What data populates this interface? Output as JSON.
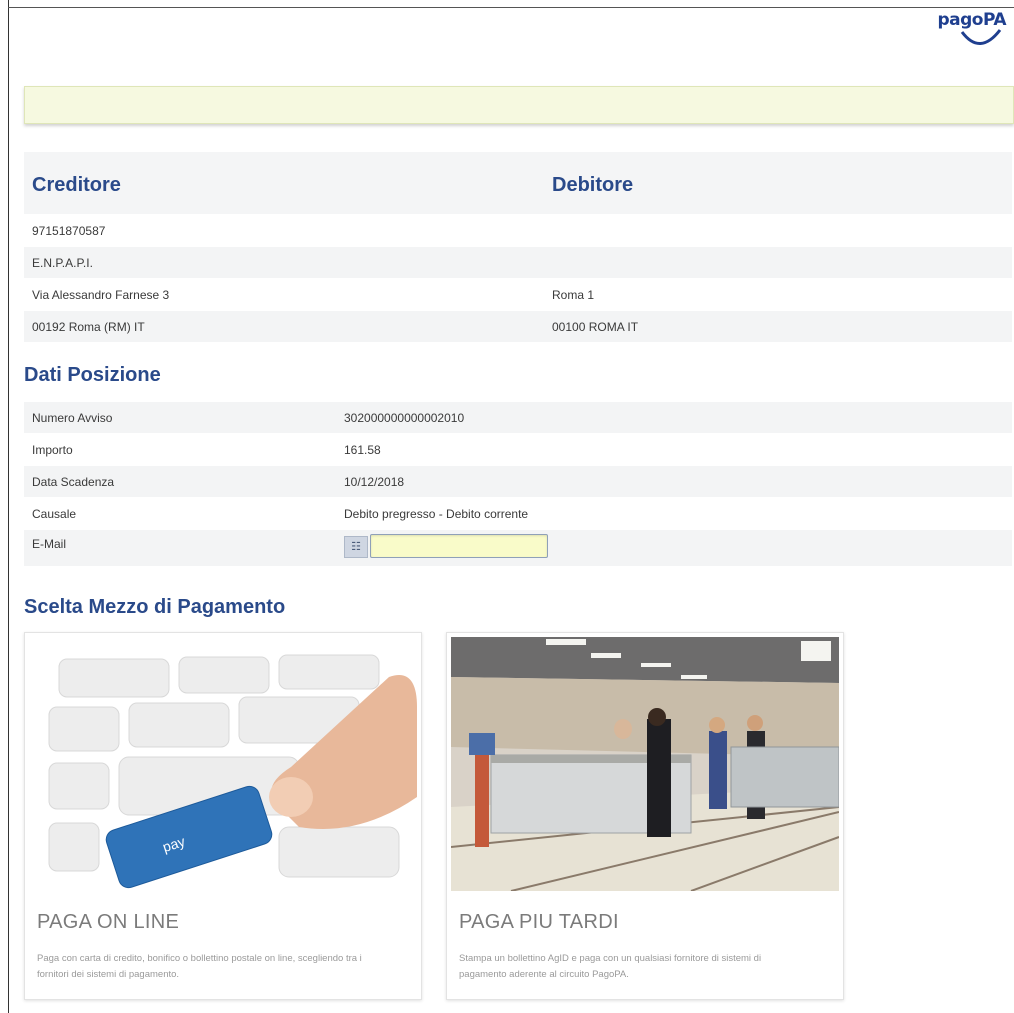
{
  "brand": {
    "logo_text": "pagoPA"
  },
  "parties": {
    "creditor_title": "Creditore",
    "debtor_title": "Debitore",
    "rows": [
      {
        "creditor": "97151870587",
        "debtor": ""
      },
      {
        "creditor": "E.N.P.A.P.I.",
        "debtor": ""
      },
      {
        "creditor": "Via Alessandro Farnese 3",
        "debtor": "Roma 1"
      },
      {
        "creditor": "00192 Roma (RM) IT",
        "debtor": "00100 ROMA IT"
      }
    ]
  },
  "position": {
    "title": "Dati Posizione",
    "rows": [
      {
        "label": "Numero Avviso",
        "value": "302000000000002010"
      },
      {
        "label": "Importo",
        "value": "161.58"
      },
      {
        "label": "Data Scadenza",
        "value": "10/12/2018"
      },
      {
        "label": "Causale",
        "value": "Debito pregresso - Debito corrente"
      },
      {
        "label": "E-Mail",
        "value": ""
      }
    ],
    "email_input_value": ""
  },
  "payment": {
    "title": "Scelta Mezzo di Pagamento",
    "options": [
      {
        "title": "PAGA ON LINE",
        "description": "Paga con carta di credito, bonifico o bollettino postale on line, scegliendo tra i fornitori dei sistemi di pagamento.",
        "image_key_label": "pay"
      },
      {
        "title": "PAGA PIU TARDI",
        "description": "Stampa un bollettino AgID e paga con un qualsiasi fornitore di sistemi di pagamento aderente al circuito PagoPA."
      }
    ]
  }
}
